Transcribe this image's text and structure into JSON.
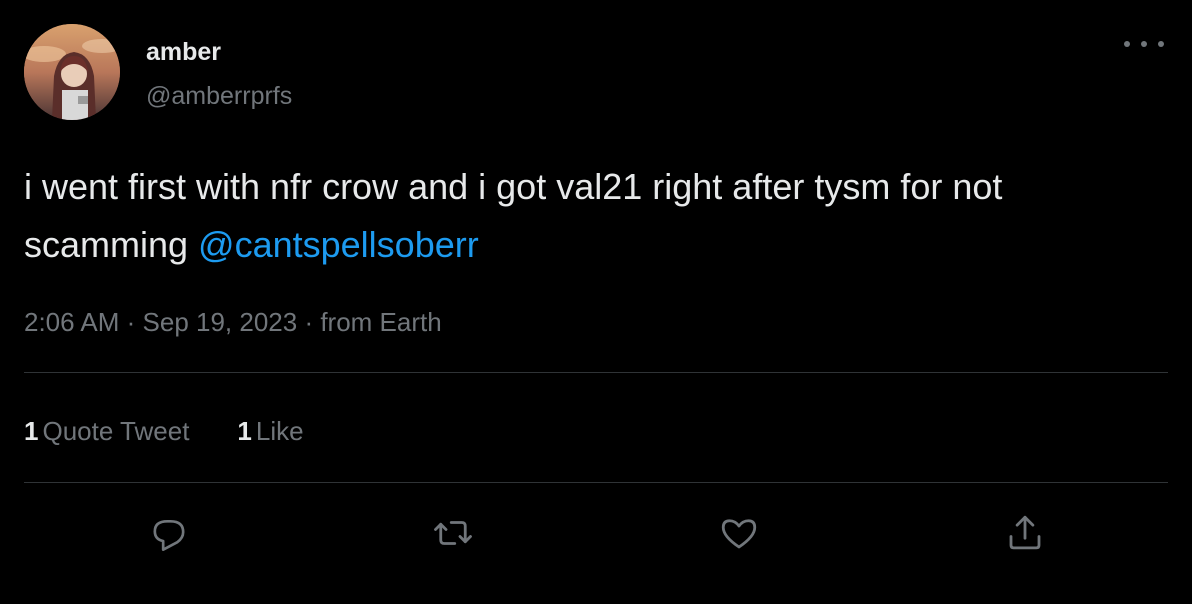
{
  "user": {
    "display_name": "amber",
    "handle": "@amberrprfs"
  },
  "tweet": {
    "text_before_mention": "i went first with nfr crow and i got val21 right after tysm for not scamming ",
    "mention": "@cantspellsoberr"
  },
  "meta": {
    "time": "2:06 AM",
    "separator": " · ",
    "date": "Sep 19, 2023",
    "source": "from Earth"
  },
  "stats": {
    "quote_count": "1",
    "quote_label": "Quote Tweet",
    "like_count": "1",
    "like_label": "Like"
  },
  "actions": {
    "reply_icon": "reply-icon",
    "retweet_icon": "retweet-icon",
    "like_icon": "heart-icon",
    "share_icon": "share-icon"
  },
  "colors": {
    "background": "#000000",
    "text": "#e7e9ea",
    "secondary": "#71767b",
    "link": "#1d9bf0",
    "divider": "#2f3336"
  }
}
